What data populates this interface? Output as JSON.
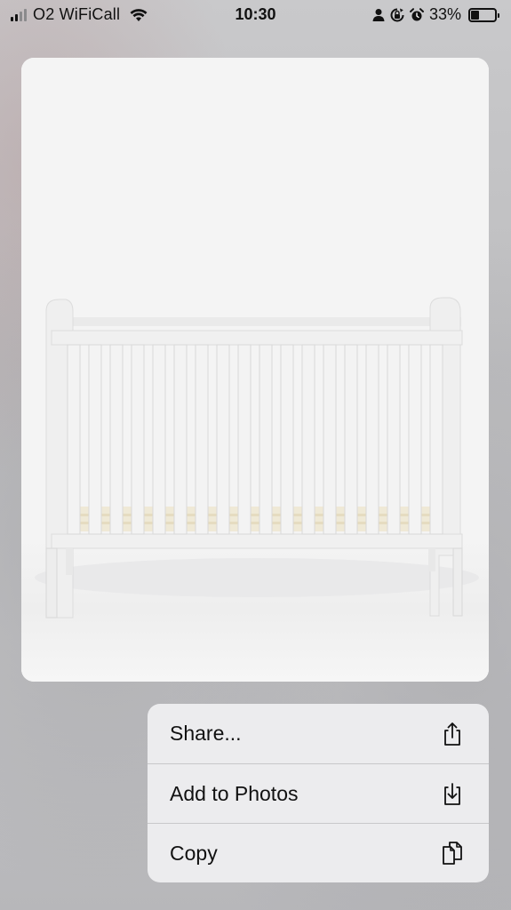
{
  "status_bar": {
    "carrier": "O2 WiFiCall",
    "time": "10:30",
    "battery": "33%",
    "battery_level": 0.33,
    "signal_bars": 2,
    "icons": [
      "signal-icon",
      "wifi-icon",
      "person-icon",
      "rotation-lock-icon",
      "alarm-icon",
      "battery-icon"
    ]
  },
  "preview": {
    "image_subject": "white-cot-image"
  },
  "context_menu": {
    "items": [
      {
        "label": "Share...",
        "icon": "share-icon"
      },
      {
        "label": "Add to Photos",
        "icon": "add-to-photos-icon"
      },
      {
        "label": "Copy",
        "icon": "copy-icon"
      }
    ]
  },
  "colors": {
    "menu_background": "#ececee",
    "card_background": "#f4f4f4",
    "backdrop": "#c0c0c2"
  }
}
